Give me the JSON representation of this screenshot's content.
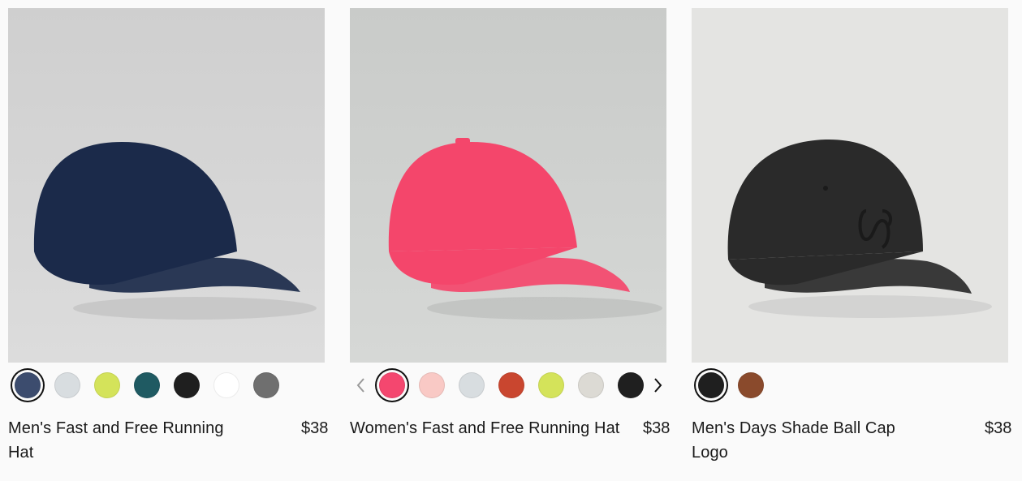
{
  "products": [
    {
      "name": "Men's Fast and Free Running Hat",
      "price": "$38",
      "image_background": "#d9d9d9",
      "cap_color": "#1b2a4a",
      "swatches": [
        "#3c4c6e",
        "#d8dde0",
        "#d4e35a",
        "#1f5a62",
        "#1f1f1f",
        "#ffffff",
        "#6f6f6f"
      ],
      "selected_swatch": 0,
      "has_arrows": false
    },
    {
      "name": "Women's Fast and Free Running Hat",
      "price": "$38",
      "image_background": "#cfd1cf",
      "cap_color": "#f4466b",
      "swatches": [
        "#f4476f",
        "#f9c9c5",
        "#d8dde0",
        "#c9462f",
        "#d4e35a",
        "#dcdad4",
        "#1f1f1f"
      ],
      "selected_swatch": 0,
      "has_arrows": true
    },
    {
      "name": "Men's Days Shade Ball Cap Logo",
      "price": "$38",
      "image_background": "#e6e6e4",
      "cap_color": "#2a2a2a",
      "swatches": [
        "#1f1f1f",
        "#8a4a2c"
      ],
      "selected_swatch": 0,
      "has_arrows": false
    }
  ],
  "icons": {
    "prev": "chevron-left-icon",
    "next": "chevron-right-icon"
  }
}
